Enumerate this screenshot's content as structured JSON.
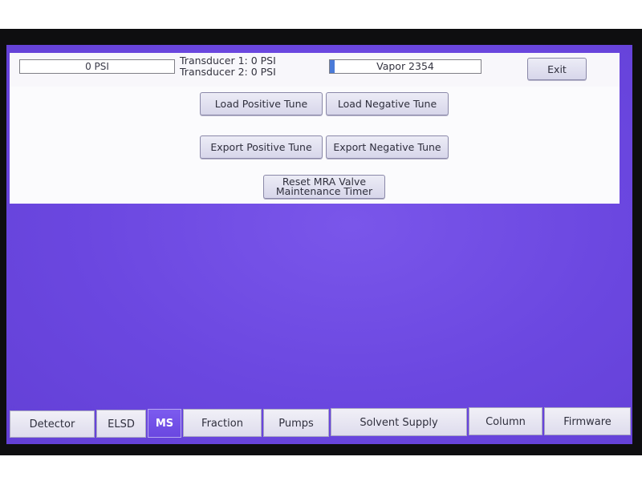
{
  "header": {
    "pressure_readout": "0 PSI",
    "transducer_1": "Transducer 1: 0 PSI",
    "transducer_2": "Transducer 2: 0 PSI",
    "vapor_label": "Vapor 2354",
    "vapor_level_fraction": 0.03,
    "exit_label": "Exit"
  },
  "ms_panel": {
    "load_positive_tune": "Load Positive Tune",
    "load_negative_tune": "Load Negative Tune",
    "export_positive_tune": "Export Positive Tune",
    "export_negative_tune": "Export Negative Tune",
    "reset_line_1": "Reset MRA Valve",
    "reset_line_2": "Maintenance Timer"
  },
  "tabs": [
    {
      "label": "Detector",
      "active": false
    },
    {
      "label": "ELSD",
      "active": false
    },
    {
      "label": "MS",
      "active": true
    },
    {
      "label": "Fraction",
      "active": false
    },
    {
      "label": "Pumps",
      "active": false
    },
    {
      "label": "Solvent Supply",
      "active": false
    },
    {
      "label": "Column",
      "active": false
    },
    {
      "label": "Firmware",
      "active": false
    }
  ],
  "colors": {
    "screen_background": "#6b47e0",
    "panel_background": "#fbfbfd",
    "active_tab": "#7c5bef",
    "vapor_fill": "#4a7bd8"
  }
}
